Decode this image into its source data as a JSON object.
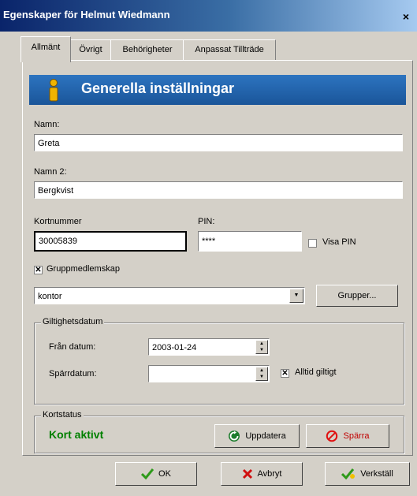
{
  "window": {
    "title": "Egenskaper för Helmut Wiedmann",
    "close_glyph": "×"
  },
  "tabs": [
    {
      "label": "Allmänt",
      "active": true
    },
    {
      "label": "Övrigt",
      "active": false
    },
    {
      "label": "Behörigheter",
      "active": false
    },
    {
      "label": "Anpassat Tillträde",
      "active": false
    }
  ],
  "header": {
    "title": "Generella inställningar",
    "icon": "info-icon"
  },
  "fields": {
    "namn_label": "Namn:",
    "namn_value": "Greta",
    "namn2_label": "Namn 2:",
    "namn2_value": "Bergkvist",
    "kortnummer_label": "Kortnummer",
    "kortnummer_value": "30005839",
    "pin_label": "PIN:",
    "pin_value": "****",
    "visa_pin_label": "Visa PIN",
    "visa_pin_checked": false,
    "gruppmedlemskap_label": "Gruppmedlemskap",
    "gruppmedlemskap_checked": true,
    "group_value": "kontor",
    "grupper_button": "Grupper..."
  },
  "giltighet": {
    "title": "Giltighetsdatum",
    "fran_label": "Från datum:",
    "fran_value": "2003-01-24",
    "sparr_label": "Spärrdatum:",
    "sparr_value": "",
    "alltid_label": "Alltid giltigt",
    "alltid_checked": true
  },
  "kortstatus": {
    "title": "Kortstatus",
    "status": "Kort aktivt",
    "update_button": "Uppdatera",
    "block_button": "Spärra"
  },
  "footer": {
    "ok": "OK",
    "cancel": "Avbryt",
    "apply": "Verkställ"
  },
  "colors": {
    "header_bg": "#1f5fa6",
    "status_green": "#008000",
    "title_bar": "#0a246a"
  }
}
